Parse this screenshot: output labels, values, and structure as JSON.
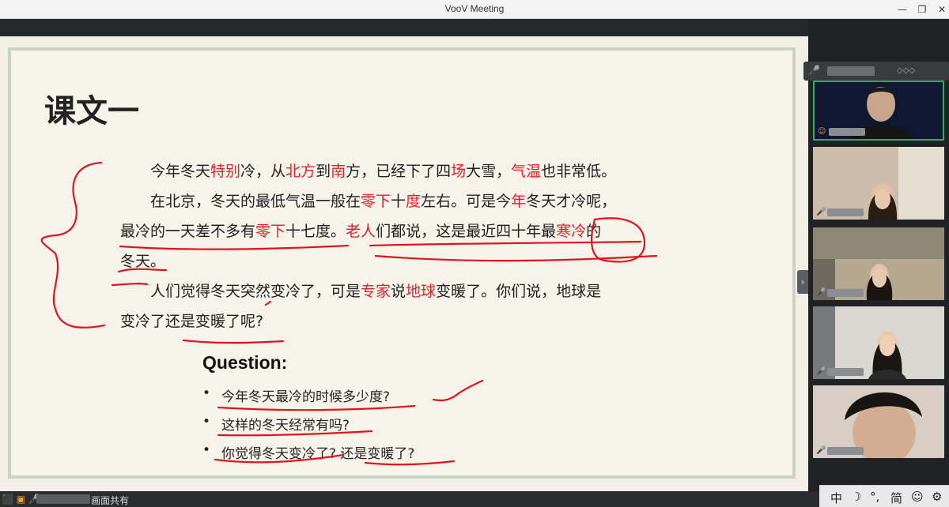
{
  "window": {
    "title": "VooV Meeting",
    "controls": [
      "—",
      "❐",
      "✕"
    ]
  },
  "slide": {
    "lesson_title": "课文一",
    "paragraph": {
      "line1": [
        {
          "t": "今年冬天",
          "red": false
        },
        {
          "t": "特别",
          "red": true
        },
        {
          "t": "冷，从",
          "red": false
        },
        {
          "t": "北方",
          "red": true
        },
        {
          "t": "到",
          "red": false
        },
        {
          "t": "南",
          "red": true
        },
        {
          "t": "方，已经下了四",
          "red": false
        },
        {
          "t": "场",
          "red": true
        },
        {
          "t": "大雪，",
          "red": false
        },
        {
          "t": "气温",
          "red": true
        },
        {
          "t": "也非常低。",
          "red": false
        }
      ],
      "line2": [
        {
          "t": "在北京，冬天的最低气温一般在",
          "red": false
        },
        {
          "t": "零下",
          "red": true
        },
        {
          "t": "十",
          "red": false
        },
        {
          "t": "度",
          "red": true
        },
        {
          "t": "左右。可是今",
          "red": false
        },
        {
          "t": "年",
          "red": true
        },
        {
          "t": "冬天才冷呢，",
          "red": false
        }
      ],
      "line3": [
        {
          "t": "最冷的一天差不多有",
          "red": false
        },
        {
          "t": "零下",
          "red": true
        },
        {
          "t": "十七度。",
          "red": false
        },
        {
          "t": "老人",
          "red": true
        },
        {
          "t": "们都说，这是最近四十年最",
          "red": false
        },
        {
          "t": "寒冷",
          "red": true
        },
        {
          "t": "的",
          "red": false
        }
      ],
      "line4": [
        {
          "t": "冬天。",
          "red": false
        }
      ],
      "line5": [
        {
          "t": "人们觉得冬天突然变冷了，可是",
          "red": false
        },
        {
          "t": "专家",
          "red": true
        },
        {
          "t": "说",
          "red": false
        },
        {
          "t": "地球",
          "red": true
        },
        {
          "t": "变暖了。你们说，地球是",
          "red": false
        }
      ],
      "line6": [
        {
          "t": "变冷了还是变暖了呢?",
          "red": false
        }
      ]
    },
    "question_title": "Question:",
    "bullet": "•",
    "questions": [
      "今年冬天最冷的时候多少度?",
      "这样的冬天经常有吗?",
      "你觉得冬天变冷了? 还是变暖了?"
    ],
    "annotation_color": "#e0151b"
  },
  "panel": {
    "collapse_glyph": "›",
    "head_mic": "🎤",
    "head_gallery": "◇◇◇"
  },
  "participants": [
    {
      "icon": "☺",
      "active_speaker": true
    },
    {
      "icon": "🎤"
    },
    {
      "icon": "🎤"
    },
    {
      "icon": "🎤"
    },
    {
      "icon": "🎤"
    }
  ],
  "bottom_bar": {
    "icons": "⬛ ▣ 🎤",
    "label": "画面共有"
  },
  "ime": {
    "items": [
      "中",
      "☽",
      "°,",
      "简",
      "☺",
      "⚙"
    ]
  }
}
